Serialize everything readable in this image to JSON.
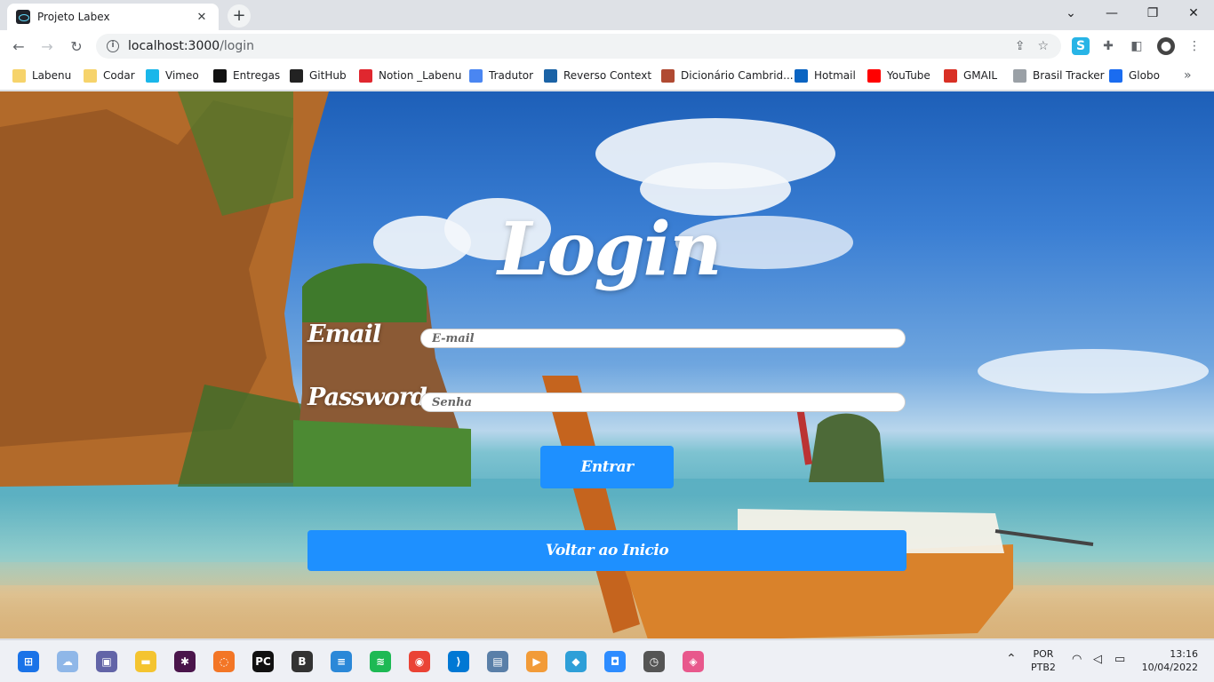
{
  "browser": {
    "tab_title": "Projeto Labex",
    "tab_close": "✕",
    "new_tab": "+",
    "url_host": "localhost:3000",
    "url_path": "/login",
    "window_controls": {
      "dropdown": "⌄",
      "minimize": "—",
      "restore": "❐",
      "close": "✕"
    },
    "nav": {
      "back": "←",
      "forward": "→",
      "reload": "↻"
    },
    "bookmarks": [
      {
        "label": "Labenu",
        "icon": "folder-icon",
        "color": "#f6d36b"
      },
      {
        "label": "Codar",
        "icon": "folder-icon",
        "color": "#f6d36b"
      },
      {
        "label": "Vimeo",
        "icon": "vimeo-icon",
        "color": "#1ab7ea"
      },
      {
        "label": "Entregas",
        "icon": "circle-icon",
        "color": "#111111"
      },
      {
        "label": "GitHub",
        "icon": "github-icon",
        "color": "#222222"
      },
      {
        "label": "Notion _Labenu",
        "icon": "apple-icon",
        "color": "#e0272f"
      },
      {
        "label": "Tradutor",
        "icon": "translate-icon",
        "color": "#4a86f2"
      },
      {
        "label": "Reverso Context",
        "icon": "reverso-icon",
        "color": "#1b63a6"
      },
      {
        "label": "Dicionário Cambrid...",
        "icon": "cambridge-icon",
        "color": "#b04a32"
      },
      {
        "label": "Hotmail",
        "icon": "outlook-icon",
        "color": "#0a64c2"
      },
      {
        "label": "YouTube",
        "icon": "youtube-icon",
        "color": "#ff0000"
      },
      {
        "label": "GMAIL",
        "icon": "gmail-icon",
        "color": "#d93025"
      },
      {
        "label": "Brasil Tracker",
        "icon": "lock-icon",
        "color": "#9aa0a6"
      },
      {
        "label": "Globo",
        "icon": "globo-icon",
        "color": "#1a6cf0"
      }
    ],
    "bookmarks_more": "»"
  },
  "login": {
    "title": "Login",
    "email_label": "Email",
    "email_placeholder": "E-mail",
    "password_label": "Password",
    "password_placeholder": "Senha",
    "submit_label": "Entrar",
    "back_label": "Voltar ao Inicio"
  },
  "taskbar": {
    "lang_top": "POR",
    "lang_bottom": "PTB2",
    "time": "13:16",
    "date": "10/04/2022",
    "apps": [
      {
        "name": "start-menu-icon",
        "glyph": "⊞",
        "color": "#1a73e8"
      },
      {
        "name": "weather-icon",
        "glyph": "☁",
        "color": "#8fb7e8"
      },
      {
        "name": "teams-chat-icon",
        "glyph": "▣",
        "color": "#6264a7"
      },
      {
        "name": "file-explorer-icon",
        "glyph": "▬",
        "color": "#f4c430"
      },
      {
        "name": "slack-icon",
        "glyph": "✱",
        "color": "#4a154b"
      },
      {
        "name": "jupyter-icon",
        "glyph": "◌",
        "color": "#f37626"
      },
      {
        "name": "pycharm-icon",
        "glyph": "PC",
        "color": "#111111"
      },
      {
        "name": "bear-icon",
        "glyph": "B",
        "color": "#333333"
      },
      {
        "name": "notepad-icon",
        "glyph": "≡",
        "color": "#2b88d8"
      },
      {
        "name": "spotify-icon",
        "glyph": "≋",
        "color": "#1db954"
      },
      {
        "name": "chrome-icon",
        "glyph": "◉",
        "color": "#ea4335"
      },
      {
        "name": "vscode-icon",
        "glyph": "⟩",
        "color": "#0078d4"
      },
      {
        "name": "photo-app-icon",
        "glyph": "▤",
        "color": "#5a7fa8"
      },
      {
        "name": "media-player-icon",
        "glyph": "▶",
        "color": "#f29b38"
      },
      {
        "name": "maps-icon",
        "glyph": "◆",
        "color": "#2e9fd8"
      },
      {
        "name": "zoom-icon",
        "glyph": "◘",
        "color": "#2d8cff"
      },
      {
        "name": "clock-app-icon",
        "glyph": "◷",
        "color": "#555555"
      },
      {
        "name": "kite-icon",
        "glyph": "◈",
        "color": "#e8588c"
      }
    ]
  }
}
